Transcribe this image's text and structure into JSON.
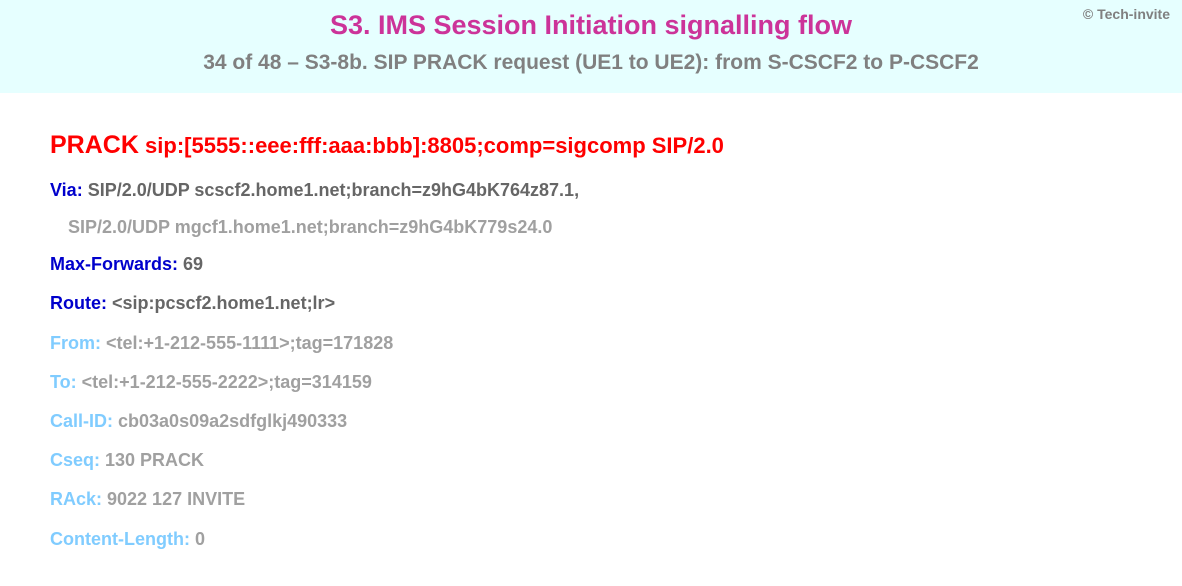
{
  "header": {
    "copyright": "© Tech-invite",
    "title": "S3. IMS Session Initiation signalling flow",
    "subtitle": "34 of 48 – S3-8b. SIP PRACK request (UE1 to UE2): from S-CSCF2 to P-CSCF2"
  },
  "sip": {
    "method": "PRACK",
    "request_uri": "sip:[5555::eee:fff:aaa:bbb]:8805;comp=sigcomp SIP/2.0",
    "headers": [
      {
        "key": "Via",
        "val": "SIP/2.0/UDP scscf2.home1.net;branch=z9hG4bK764z87.1,",
        "style": "dark",
        "cont": "SIP/2.0/UDP mgcf1.home1.net;branch=z9hG4bK779s24.0"
      },
      {
        "key": "Max-Forwards",
        "val": "69",
        "style": "dark"
      },
      {
        "key": "Route",
        "val": "<sip:pcscf2.home1.net;lr>",
        "style": "dark"
      },
      {
        "key": "From",
        "val": "<tel:+1-212-555-1111>;tag=171828",
        "style": "light"
      },
      {
        "key": "To",
        "val": "<tel:+1-212-555-2222>;tag=314159",
        "style": "light"
      },
      {
        "key": "Call-ID",
        "val": "cb03a0s09a2sdfglkj490333",
        "style": "light"
      },
      {
        "key": "Cseq",
        "val": "130 PRACK",
        "style": "light"
      },
      {
        "key": "RAck",
        "val": "9022 127 INVITE",
        "style": "light"
      },
      {
        "key": "Content-Length",
        "val": "0",
        "style": "light"
      }
    ]
  }
}
